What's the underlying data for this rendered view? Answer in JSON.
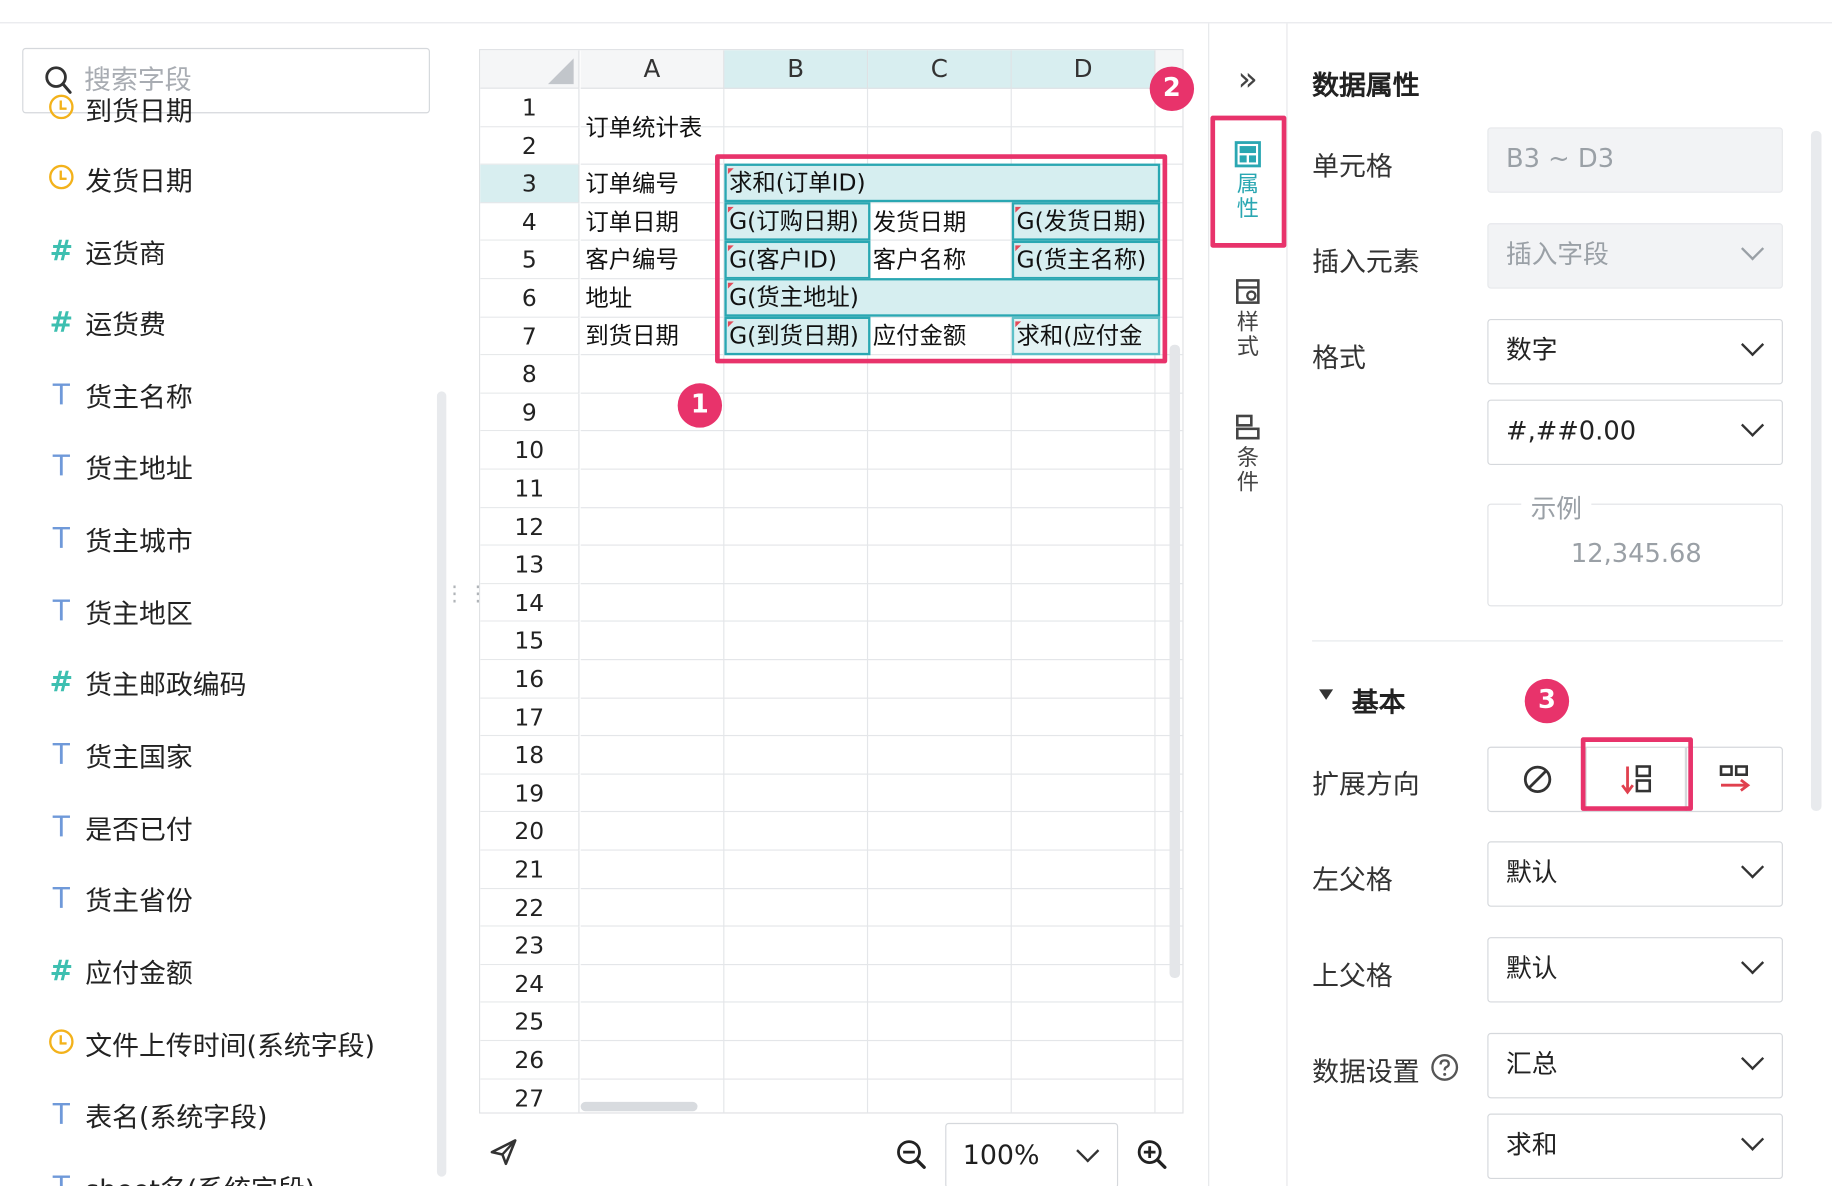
{
  "field_panel": {
    "search_placeholder": "搜索字段",
    "fields": [
      {
        "type": "date",
        "label": "到货日期",
        "icon": "clock-icon"
      },
      {
        "type": "date",
        "label": "发货日期",
        "icon": "clock-icon"
      },
      {
        "type": "number",
        "label": "运货商",
        "icon": "hash-icon"
      },
      {
        "type": "number",
        "label": "运货费",
        "icon": "hash-icon"
      },
      {
        "type": "text",
        "label": "货主名称",
        "icon": "text-t-icon"
      },
      {
        "type": "text",
        "label": "货主地址",
        "icon": "text-t-icon"
      },
      {
        "type": "text",
        "label": "货主城市",
        "icon": "text-t-icon"
      },
      {
        "type": "text",
        "label": "货主地区",
        "icon": "text-t-icon"
      },
      {
        "type": "number",
        "label": "货主邮政编码",
        "icon": "hash-icon"
      },
      {
        "type": "text",
        "label": "货主国家",
        "icon": "text-t-icon"
      },
      {
        "type": "text",
        "label": "是否已付",
        "icon": "text-t-icon"
      },
      {
        "type": "text",
        "label": "货主省份",
        "icon": "text-t-icon"
      },
      {
        "type": "number",
        "label": "应付金额",
        "icon": "hash-icon"
      },
      {
        "type": "date",
        "label": "文件上传时间(系统字段)",
        "icon": "clock-icon"
      },
      {
        "type": "text",
        "label": "表名(系统字段)",
        "icon": "text-t-icon"
      },
      {
        "type": "text",
        "label": "sheet名(系统字段)",
        "icon": "text-t-icon"
      }
    ]
  },
  "sheet": {
    "columns": [
      "A",
      "B",
      "C",
      "D"
    ],
    "rows": [
      "1",
      "2",
      "3",
      "4",
      "5",
      "6",
      "7",
      "8",
      "9",
      "10",
      "11",
      "12",
      "13",
      "14",
      "15",
      "16",
      "17",
      "18",
      "19",
      "20",
      "21",
      "22",
      "23",
      "24",
      "25",
      "26",
      "27"
    ],
    "title": "订单统计表",
    "a_labels": {
      "r3": "订单编号",
      "r4": "订单日期",
      "r5": "客户编号",
      "r6": "地址",
      "r7": "到货日期"
    },
    "c_labels": {
      "r4": "发货日期",
      "r5": "客户名称",
      "r7": "应付金额"
    },
    "tags": {
      "b3": "求和(订单ID)",
      "b4": "G(订购日期)",
      "d4": "G(发货日期)",
      "b5": "G(客户ID)",
      "d5": "G(货主名称)",
      "b6": "G(货主地址)",
      "b7": "G(到货日期)",
      "d7": "求和(应付金"
    }
  },
  "badges": {
    "one": "1",
    "two": "2",
    "three": "3"
  },
  "zoom": {
    "value": "100%"
  },
  "side_tabs": {
    "collapse": "»",
    "properties": "属性",
    "style": "样式",
    "condition": "条件"
  },
  "properties": {
    "title": "数据属性",
    "cell_label": "单元格",
    "cell_value": "B3 ~ D3",
    "insert_label": "插入元素",
    "insert_value": "插入字段",
    "format_label": "格式",
    "format_value": "数字",
    "format_pattern": "#,##0.00",
    "example_label": "示例",
    "example_value": "12,345.68",
    "section_basic": "基本",
    "expand_label": "扩展方向",
    "left_parent_label": "左父格",
    "left_parent_value": "默认",
    "top_parent_label": "上父格",
    "top_parent_value": "默认",
    "data_setting_label": "数据设置",
    "data_setting_value": "汇总",
    "aggregate_value": "求和"
  },
  "colors": {
    "accent": "#2aa7b2",
    "highlight": "#e8336b",
    "cell_fill": "#d6eef0"
  }
}
